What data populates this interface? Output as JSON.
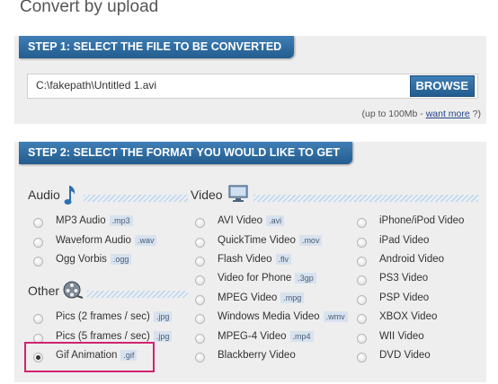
{
  "page": {
    "title": "Convert by upload"
  },
  "step1": {
    "title": "STEP 1: SELECT THE FILE TO BE CONVERTED",
    "file_path": "C:\\fakepath\\Untitled 1.avi",
    "browse_label": "BROWSE",
    "size_note_prefix": "(up to 100Mb - ",
    "size_note_link": "want more",
    "size_note_suffix": " ?)"
  },
  "step2": {
    "title": "STEP 2: SELECT THE FORMAT YOU WOULD LIKE TO GET",
    "audio": {
      "label": "Audio",
      "icon": "music-note-icon",
      "options": [
        {
          "name": "MP3 Audio",
          "ext": ".mp3"
        },
        {
          "name": "Waveform Audio",
          "ext": ".wav"
        },
        {
          "name": "Ogg Vorbis",
          "ext": ".ogg"
        }
      ]
    },
    "other": {
      "label": "Other",
      "icon": "film-reel-icon",
      "options": [
        {
          "name": "Pics (2 frames / sec)",
          "ext": ".jpg"
        },
        {
          "name": "Pics (5 frames / sec)",
          "ext": ".jpg"
        },
        {
          "name": "Gif Animation",
          "ext": ".gif",
          "selected": true
        }
      ]
    },
    "video": {
      "label": "Video",
      "icon": "monitor-icon",
      "options": [
        {
          "name": "AVI Video",
          "ext": ".avi"
        },
        {
          "name": "QuickTime Video",
          "ext": ".mov"
        },
        {
          "name": "Flash Video",
          "ext": ".flv"
        },
        {
          "name": "Video for Phone",
          "ext": ".3gp"
        },
        {
          "name": "MPEG Video",
          "ext": ".mpg"
        },
        {
          "name": "Windows Media Video",
          "ext": ".wmv"
        },
        {
          "name": "MPEG-4 Video",
          "ext": ".mp4"
        },
        {
          "name": "Blackberry Video",
          "ext": ""
        }
      ]
    },
    "devices": {
      "options": [
        {
          "name": "iPhone/iPod Video"
        },
        {
          "name": "iPad Video"
        },
        {
          "name": "Android Video"
        },
        {
          "name": "PS3 Video"
        },
        {
          "name": "PSP Video"
        },
        {
          "name": "XBOX Video"
        },
        {
          "name": "WII Video"
        },
        {
          "name": "DVD Video"
        }
      ]
    }
  },
  "colors": {
    "accent": "#2f6ea4",
    "highlight": "#d0246f",
    "panel": "#eeeeee"
  }
}
